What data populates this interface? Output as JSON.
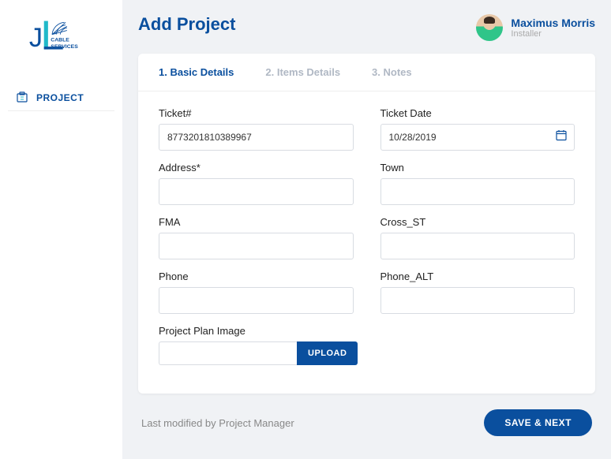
{
  "brand": {
    "name": "JL Cable Services"
  },
  "nav": {
    "project": "PROJECT"
  },
  "header": {
    "title": "Add Project"
  },
  "user": {
    "name": "Maximus Morris",
    "role": "Installer"
  },
  "tabs": {
    "basic": "1. Basic Details",
    "items": "2. Items Details",
    "notes": "3. Notes"
  },
  "form": {
    "ticket_label": "Ticket#",
    "ticket_value": "8773201810389967",
    "ticket_date_label": "Ticket Date",
    "ticket_date_value": "10/28/2019",
    "address_label": "Address*",
    "address_value": "",
    "town_label": "Town",
    "town_value": "",
    "fma_label": "FMA",
    "fma_value": "",
    "cross_st_label": "Cross_ST",
    "cross_st_value": "",
    "phone_label": "Phone",
    "phone_value": "",
    "phone_alt_label": "Phone_ALT",
    "phone_alt_value": "",
    "plan_image_label": "Project Plan Image",
    "upload_label": "UPLOAD"
  },
  "footer": {
    "modified": "Last modified by Project Manager",
    "save": "SAVE & NEXT"
  }
}
